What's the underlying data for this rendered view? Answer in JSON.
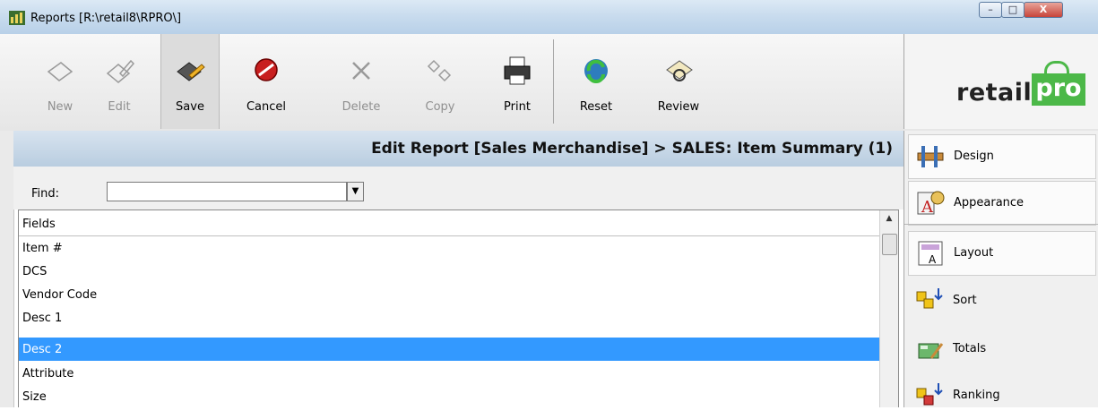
{
  "window": {
    "title": "Reports [R:\\retail8\\RPRO\\]",
    "controls": {
      "minimize": "–",
      "maximize": "□",
      "close": "X"
    }
  },
  "toolbar": {
    "buttons": [
      {
        "label": "New",
        "icon": "new-document-icon",
        "enabled": false
      },
      {
        "label": "Edit",
        "icon": "edit-pencil-icon",
        "enabled": false
      },
      {
        "label": "Save",
        "icon": "save-icon",
        "enabled": true,
        "active": true
      },
      {
        "label": "Cancel",
        "icon": "cancel-icon",
        "enabled": true
      },
      {
        "label": "Delete",
        "icon": "delete-icon",
        "enabled": false
      },
      {
        "label": "Copy",
        "icon": "copy-icon",
        "enabled": false
      },
      {
        "label": "Print",
        "icon": "printer-icon",
        "enabled": true
      },
      {
        "label": "Reset",
        "icon": "reset-icon",
        "enabled": true
      },
      {
        "label": "Review",
        "icon": "review-icon",
        "enabled": true
      }
    ],
    "logo": {
      "text_left": "retail",
      "text_right": "pro",
      "brand_color": "#4cb848"
    }
  },
  "main": {
    "header": "Edit Report [Sales Merchandise] > SALES: Item Summary (1)",
    "find": {
      "label": "Find:",
      "value": ""
    },
    "fields": {
      "header": "Fields",
      "rows": [
        "Item #",
        "DCS",
        "Vendor Code",
        "Desc 1",
        "Desc 2",
        "Attribute",
        "Size"
      ],
      "selected_index": 4,
      "selection_color": "#3399ff"
    }
  },
  "side_panel": {
    "items": [
      {
        "label": "Design",
        "icon": "design-icon"
      },
      {
        "label": "Appearance",
        "icon": "appearance-icon"
      },
      {
        "label": "Layout",
        "icon": "layout-icon"
      },
      {
        "label": "Sort",
        "icon": "sort-icon"
      },
      {
        "label": "Totals",
        "icon": "totals-icon"
      },
      {
        "label": "Ranking",
        "icon": "ranking-icon"
      }
    ]
  }
}
